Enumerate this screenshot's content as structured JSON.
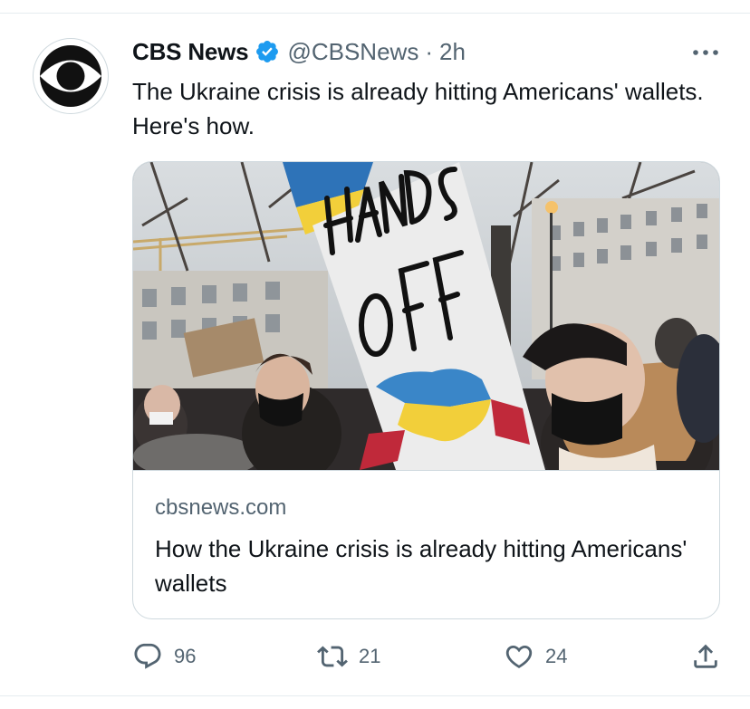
{
  "author": {
    "name": "CBS News",
    "handle": "@CBSNews",
    "separator": "·",
    "time": "2h",
    "verified": true,
    "avatar_icon": "cbs-eye-logo"
  },
  "tweet": {
    "text": "The Ukraine crisis is already hitting Americans' wallets. Here's how."
  },
  "card": {
    "image_description_icon": "protest-photo",
    "sign_text_line1": "HANDS",
    "sign_text_line2": "OFF",
    "domain": "cbsnews.com",
    "title": "How the Ukraine crisis is already hitting Americans' wallets"
  },
  "actions": {
    "reply": {
      "icon": "reply-icon",
      "count": "96"
    },
    "retweet": {
      "icon": "retweet-icon",
      "count": "21"
    },
    "like": {
      "icon": "heart-icon",
      "count": "24"
    },
    "share": {
      "icon": "share-icon"
    }
  },
  "colors": {
    "text_primary": "#0f1419",
    "text_secondary": "#536471",
    "verified_blue": "#1d9bf0",
    "border": "#cfd9de"
  }
}
